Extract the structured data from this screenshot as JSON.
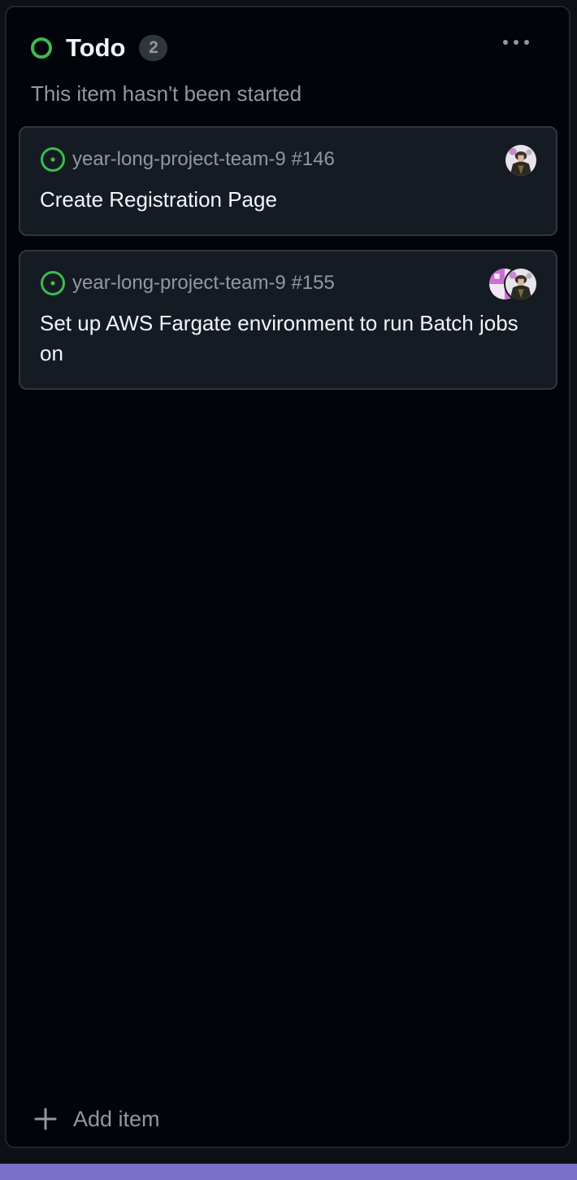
{
  "column": {
    "title": "Todo",
    "count": "2",
    "description": "This item hasn't been started",
    "status_color": "#3fb950",
    "menu_icon": "kebab-horizontal-icon"
  },
  "cards": [
    {
      "ref": "year-long-project-team-9 #146",
      "title": "Create Registration Page",
      "state_icon": "issue-opened-icon",
      "assignees": [
        "avatar-gray"
      ]
    },
    {
      "ref": "year-long-project-team-9 #155",
      "title": "Set up AWS Fargate environment to run Batch jobs on",
      "state_icon": "issue-opened-icon",
      "assignees": [
        "avatar-pink",
        "avatar-gray"
      ]
    }
  ],
  "footer": {
    "add_item_label": "Add item",
    "add_icon": "plus-icon"
  },
  "colors": {
    "background": "#010409",
    "card_background": "#151b23",
    "accent_bar": "#7c6fc9",
    "text_primary": "#f0f6fc",
    "text_muted": "#9198a1"
  }
}
